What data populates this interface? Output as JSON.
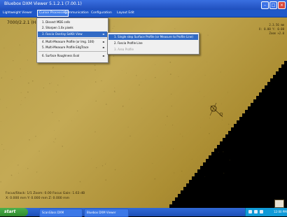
{
  "window": {
    "title": "Bluebox DXM Viewer 5.1.2.1 (7.00.1)",
    "min_glyph": "–",
    "max_glyph": "□",
    "close_glyph": "×"
  },
  "menubar": {
    "items": [
      {
        "label": "Lightweight Viewer"
      },
      {
        "label": "Cursor Processing"
      },
      {
        "label": "Communication"
      },
      {
        "label": "Configuration"
      },
      {
        "label": "Layout Edit"
      }
    ]
  },
  "dropdown": {
    "items": [
      {
        "label": "1. Dissect MDE cells",
        "has_submenu": false
      },
      {
        "label": "2. Sharpen 1.0x pixels",
        "has_submenu": false
      },
      {
        "label": "3. Fascia Overlay SelKit View",
        "has_submenu": true,
        "highlighted": true
      },
      {
        "label": "4. Multi-Measure Profile (or Img. 100)",
        "has_submenu": true
      },
      {
        "label": "5. Multi-Measure Profile EdgTrace",
        "has_submenu": true
      },
      {
        "label": "6. Surface Roughness Eval",
        "has_submenu": true
      }
    ]
  },
  "submenu": {
    "items": [
      {
        "label": "1. Single step Surface Profile (or Measure to Profile Line)",
        "highlighted": true
      },
      {
        "label": "2. Fascia Profile Line",
        "disabled": false
      },
      {
        "label": "3. Area Profile",
        "disabled": true
      }
    ]
  },
  "viewer": {
    "overlay_tl": "7000/2.2.1 (Hi-ID)",
    "overlay_tr": "2.3.56 mm\nX: 0.00 Y: 0.00\nZoom ×2.0",
    "overlay_bl": [
      "Focus/Stack: 1/1 Zoom: 0.00 Focus Gain: 1.63 dB",
      "X: 0.000 mm   Y: 0.000 mm   Z: 0.000 mm"
    ],
    "bg_color": "#bca24c",
    "edge_color": "#000000"
  },
  "taskbar": {
    "start_label": "start",
    "tasks": [
      "ScanGlass DXM",
      "Bluebox DXM Viewer"
    ],
    "time": "12:00 PM"
  }
}
